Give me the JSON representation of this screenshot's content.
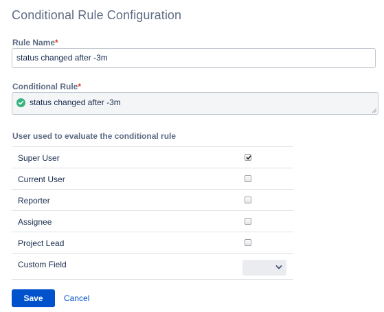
{
  "page": {
    "title": "Conditional Rule Configuration"
  },
  "rule_name": {
    "label": "Rule Name",
    "required_mark": "*",
    "value": "status changed after -3m"
  },
  "conditional_rule": {
    "label": "Conditional Rule",
    "required_mark": "*",
    "value": "status changed after -3m",
    "valid_icon": "check-circle-icon",
    "valid_color": "#36b37e"
  },
  "evaluation": {
    "section_title": "User used to evaluate the conditional rule",
    "options": [
      {
        "label": "Super User",
        "checked": true
      },
      {
        "label": "Current User",
        "checked": false
      },
      {
        "label": "Reporter",
        "checked": false
      },
      {
        "label": "Assignee",
        "checked": false
      },
      {
        "label": "Project Lead",
        "checked": false
      }
    ],
    "custom_field": {
      "label": "Custom Field",
      "selected": ""
    }
  },
  "actions": {
    "save_label": "Save",
    "cancel_label": "Cancel",
    "primary_color": "#0052cc"
  }
}
